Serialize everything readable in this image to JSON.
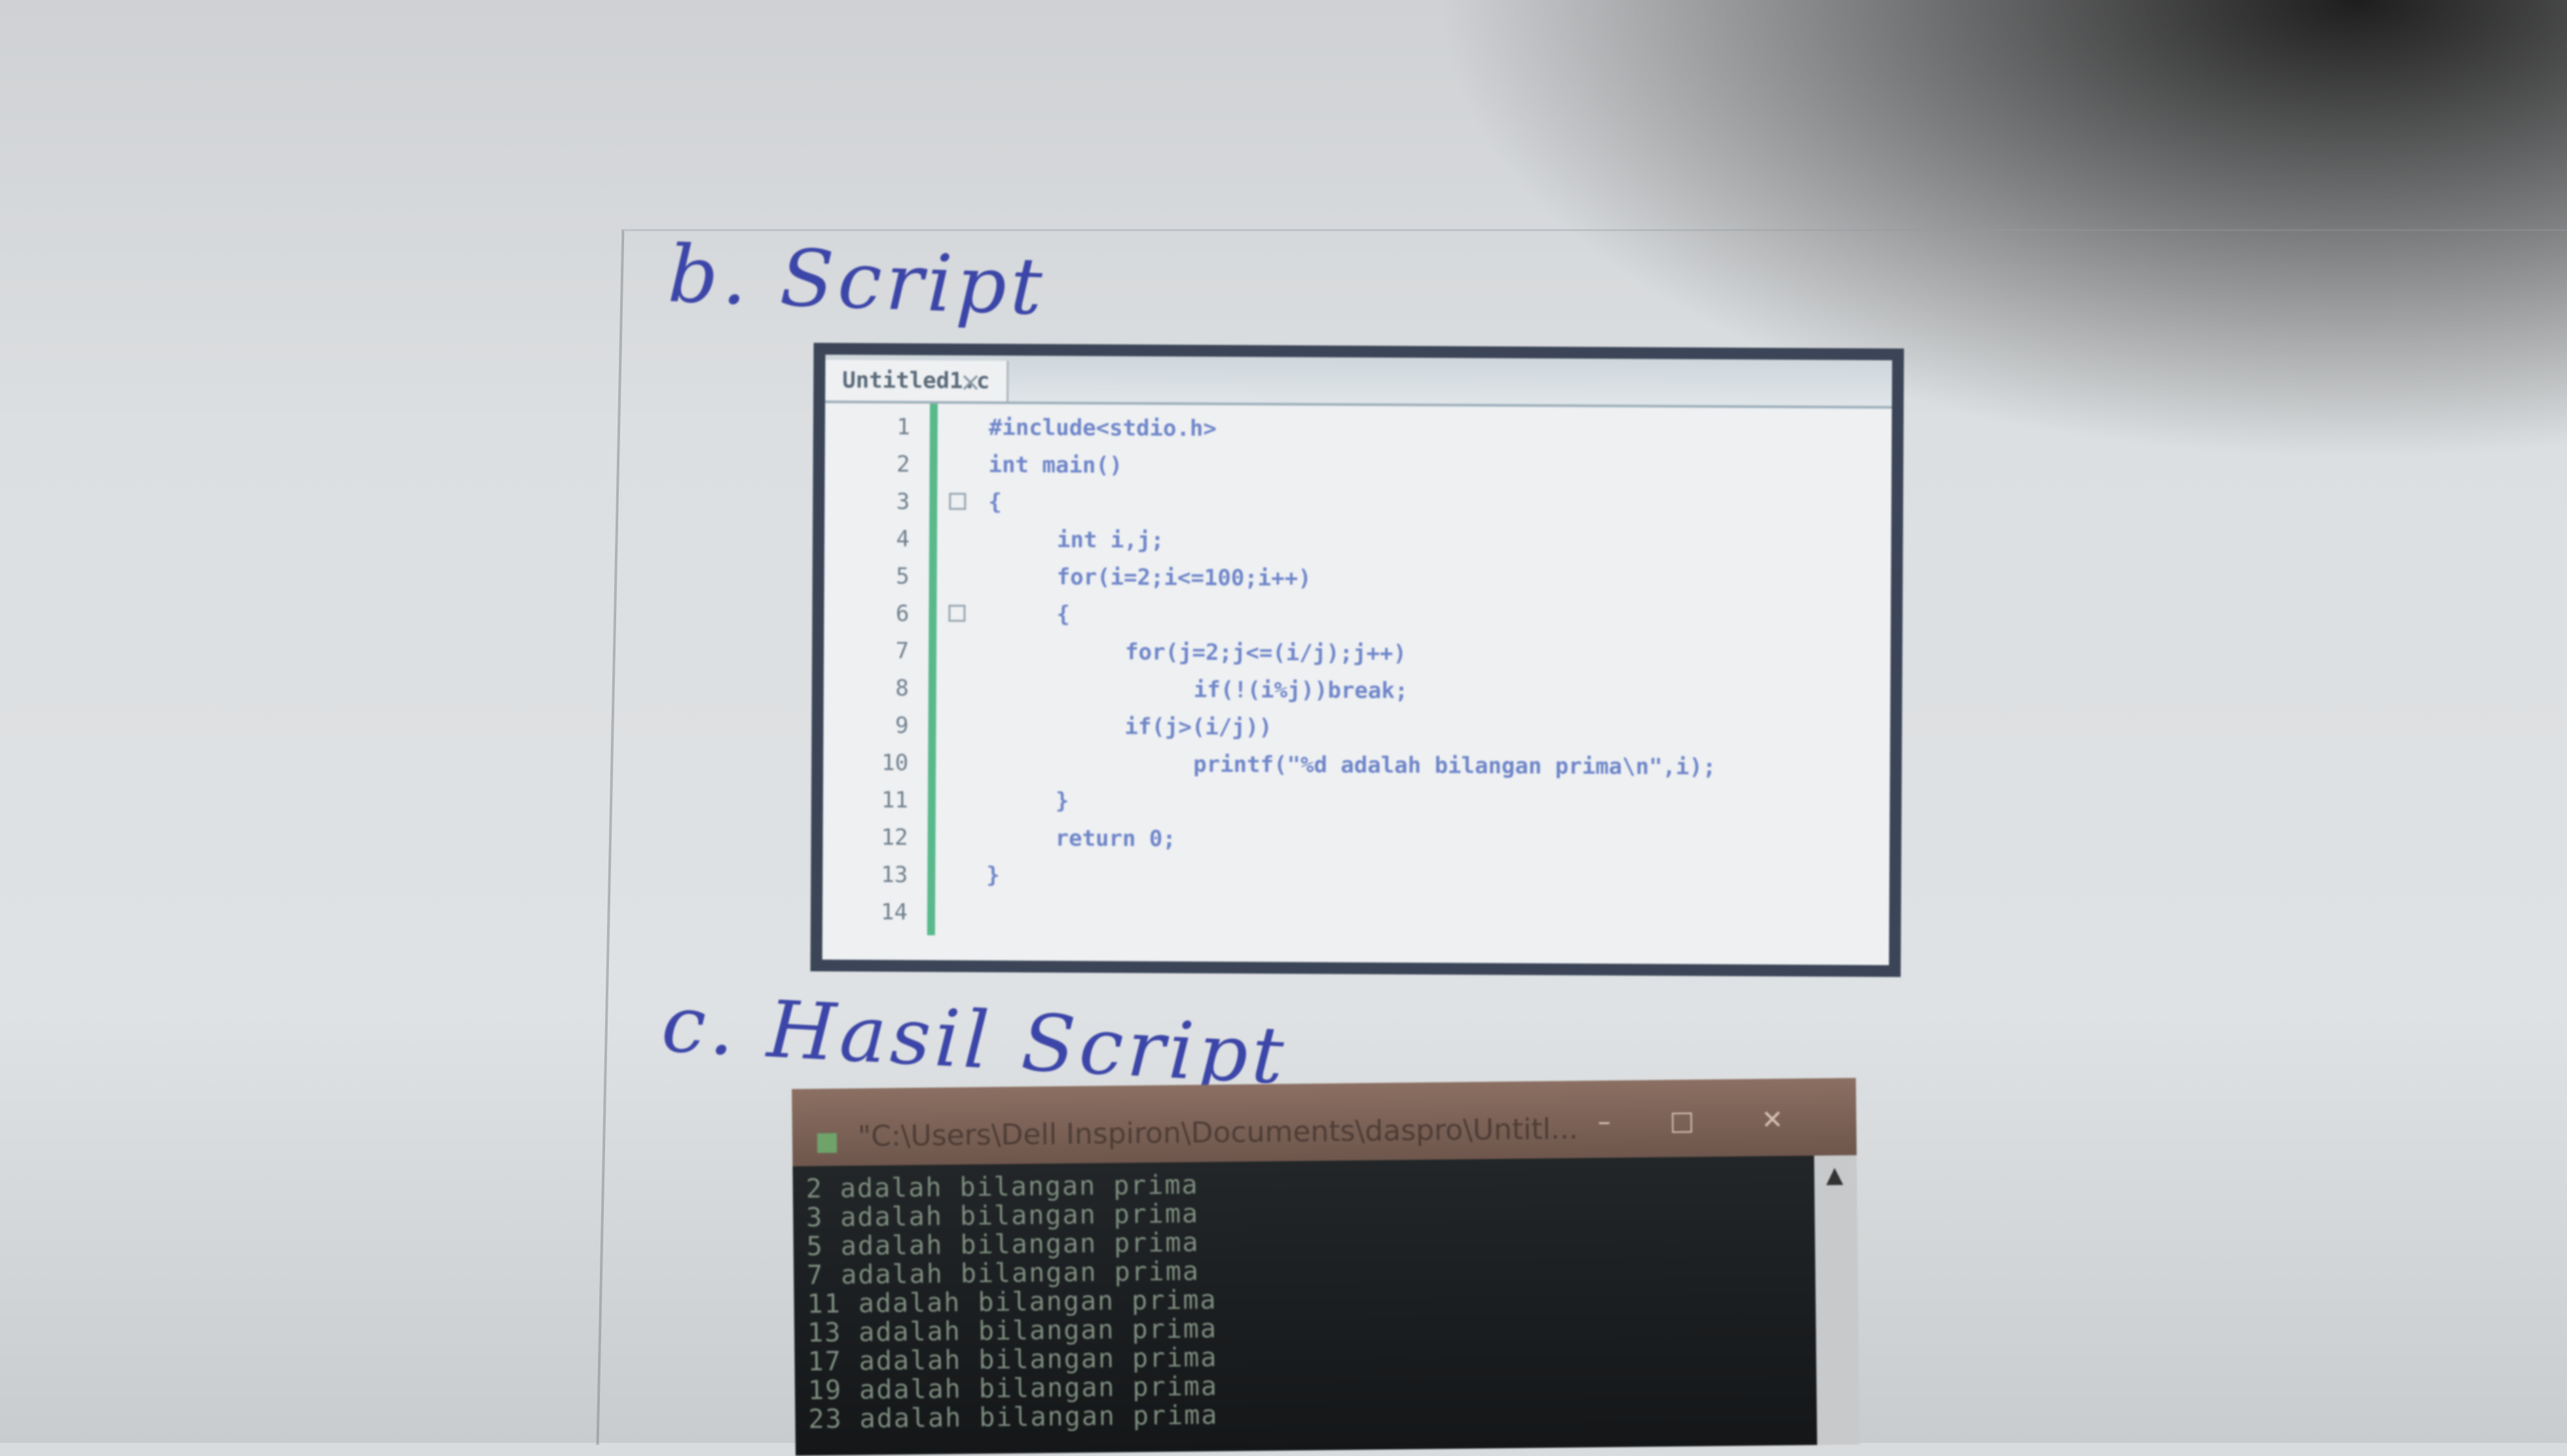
{
  "handwriting": {
    "section_b": "b. Script",
    "section_c": "c. Hasil Script"
  },
  "editor": {
    "tab_label": "Untitled1.c",
    "tab_close": "×",
    "lines": [
      {
        "n": "1",
        "code": "#include<stdio.h>",
        "indent": 0
      },
      {
        "n": "2",
        "code": "int main()",
        "indent": 0
      },
      {
        "n": "3",
        "code": "{",
        "indent": 0
      },
      {
        "n": "4",
        "code": "int i,j;",
        "indent": 1
      },
      {
        "n": "5",
        "code": "for(i=2;i<=100;i++)",
        "indent": 1
      },
      {
        "n": "6",
        "code": "{",
        "indent": 1
      },
      {
        "n": "7",
        "code": "for(j=2;j<=(i/j);j++)",
        "indent": 2
      },
      {
        "n": "8",
        "code": "if(!(i%j))break;",
        "indent": 3
      },
      {
        "n": "9",
        "code": "if(j>(i/j))",
        "indent": 2
      },
      {
        "n": "10",
        "code": "printf(\"%d adalah bilangan prima\\n\",i);",
        "indent": 3
      },
      {
        "n": "11",
        "code": "}",
        "indent": 1
      },
      {
        "n": "12",
        "code": "return 0;",
        "indent": 1
      },
      {
        "n": "13",
        "code": "}",
        "indent": 0
      },
      {
        "n": "14",
        "code": "",
        "indent": 0
      }
    ]
  },
  "console": {
    "title": "\"C:\\Users\\Dell Inspiron\\Documents\\daspro\\Untitl...",
    "minimize": "–",
    "maximize": "□",
    "close": "✕",
    "scroll_up": "▲",
    "output": [
      "2 adalah bilangan prima",
      "3 adalah bilangan prima",
      "5 adalah bilangan prima",
      "7 adalah bilangan prima",
      "11 adalah bilangan prima",
      "13 adalah bilangan prima",
      "17 adalah bilangan prima",
      "19 adalah bilangan prima",
      "23 adalah bilangan prima"
    ]
  }
}
